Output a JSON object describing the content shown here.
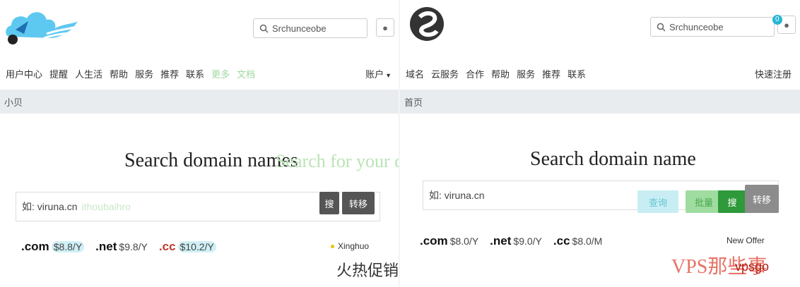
{
  "left": {
    "search": {
      "value": "Srchunceobe",
      "placeholder": "Srchunceobe"
    },
    "nav": {
      "items": [
        "用户中心",
        "提醒",
        "人生活",
        "帮助",
        "服务",
        "推荐",
        "联系"
      ],
      "faded_items": [
        "更多",
        "文档"
      ],
      "right_label": "账户"
    },
    "breadcrumb": "小贝",
    "heading": "Search domain names",
    "heading_ghost": "Search for your domain name",
    "input": {
      "value": "如: viruna.cn",
      "ghost": "ithoubaihro"
    },
    "buttons": {
      "search": "搜",
      "transfer": "转移"
    },
    "tlds": [
      {
        "name": ".com",
        "price": "$8.8/Y",
        "highlight": true
      },
      {
        "name": ".net",
        "price": "$9.8/Y",
        "highlight": false
      },
      {
        "name": ".cc",
        "price": "$10.2/Y",
        "highlight": true
      }
    ],
    "promo": "Xinghuo",
    "promo_big": "火热促销"
  },
  "right": {
    "search": {
      "value": "Srchunceobe",
      "placeholder": "Srchunceobe"
    },
    "cart_count": "0",
    "nav": {
      "items": [
        "域名",
        "云服务",
        "合作",
        "帮助",
        "服务",
        "推荐",
        "联系"
      ],
      "right_label": "快速注册"
    },
    "breadcrumb": "首页",
    "heading": "Search domain name",
    "input": {
      "value": "如: viruna.cn"
    },
    "buttons": {
      "a": "查询",
      "b": "批量",
      "search": "搜",
      "transfer": "转移"
    },
    "tlds": [
      {
        "name": ".com",
        "price": "$8.0/Y"
      },
      {
        "name": ".net",
        "price": "$9.0/Y"
      },
      {
        "name": ".cc",
        "price": "$8.0/M"
      }
    ],
    "promo": "New Offer"
  },
  "watermark": "VPS那些事",
  "sub_watermark": "vpsgo"
}
